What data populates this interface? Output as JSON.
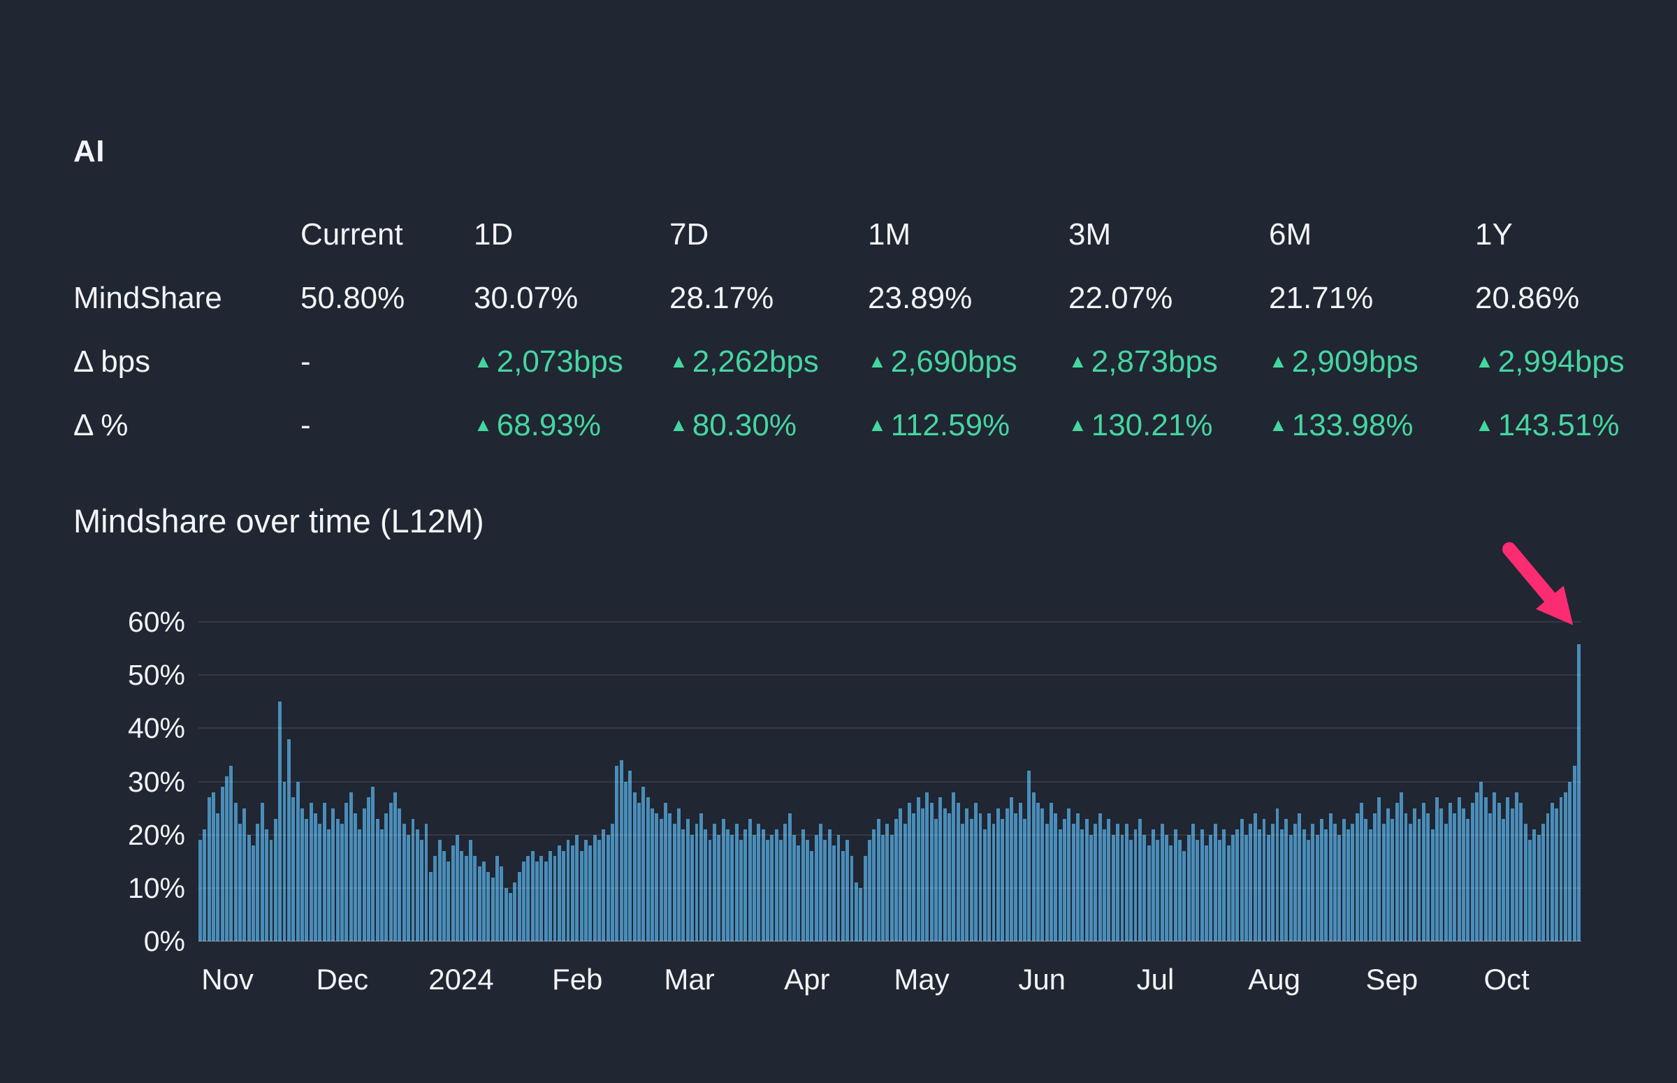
{
  "page": {
    "title": "AI"
  },
  "table": {
    "columns": [
      "Current",
      "1D",
      "7D",
      "1M",
      "3M",
      "6M",
      "1Y"
    ],
    "rows": [
      {
        "label": "MindShare",
        "values": [
          "50.80%",
          "30.07%",
          "28.17%",
          "23.89%",
          "22.07%",
          "21.71%",
          "20.86%"
        ]
      },
      {
        "label": "Δ bps",
        "values": [
          "-",
          "2,073bps",
          "2,262bps",
          "2,690bps",
          "2,873bps",
          "2,909bps",
          "2,994bps"
        ]
      },
      {
        "label": "Δ %",
        "values": [
          "-",
          "68.93%",
          "80.30%",
          "112.59%",
          "130.21%",
          "133.98%",
          "143.51%"
        ]
      }
    ],
    "up_triangle": "▲"
  },
  "section": {
    "heading": "Mindshare over time (L12M)"
  },
  "chart_data": {
    "type": "bar",
    "title": "Mindshare over time (L12M)",
    "xlabel": "",
    "ylabel": "",
    "ylim": [
      0,
      60
    ],
    "grid": true,
    "yticks": [
      "0%",
      "10%",
      "20%",
      "30%",
      "40%",
      "50%",
      "60%"
    ],
    "x_labels": [
      "Nov",
      "Dec",
      "2024",
      "Feb",
      "Mar",
      "Apr",
      "May",
      "Jun",
      "Jul",
      "Aug",
      "Sep",
      "Oct"
    ],
    "x_label_fractions": [
      0.021,
      0.104,
      0.19,
      0.274,
      0.355,
      0.44,
      0.523,
      0.61,
      0.692,
      0.778,
      0.863,
      0.946
    ],
    "current_value_pct": 50.8,
    "values": [
      19,
      21,
      27,
      28,
      24,
      29,
      31,
      33,
      26,
      22,
      25,
      20,
      18,
      22,
      26,
      21,
      19,
      23,
      45,
      30,
      38,
      27,
      30,
      25,
      23,
      26,
      24,
      22,
      26,
      21,
      25,
      23,
      22,
      26,
      28,
      24,
      21,
      25,
      27,
      29,
      23,
      21,
      24,
      26,
      28,
      25,
      22,
      20,
      23,
      21,
      19,
      22,
      13,
      16,
      19,
      17,
      15,
      18,
      20,
      17,
      16,
      19,
      16,
      14,
      15,
      13,
      12,
      16,
      14,
      10,
      9,
      11,
      13,
      15,
      16,
      17,
      15,
      16,
      15,
      17,
      16,
      18,
      17,
      19,
      18,
      20,
      17,
      19,
      18,
      20,
      19,
      21,
      20,
      22,
      33,
      34,
      30,
      32,
      28,
      26,
      29,
      27,
      25,
      24,
      23,
      26,
      24,
      22,
      25,
      21,
      23,
      20,
      22,
      24,
      21,
      19,
      22,
      20,
      23,
      21,
      20,
      22,
      19,
      21,
      23,
      20,
      22,
      21,
      19,
      20,
      21,
      19,
      22,
      24,
      20,
      18,
      21,
      19,
      17,
      20,
      22,
      19,
      21,
      18,
      20,
      17,
      19,
      16,
      11,
      10,
      16,
      19,
      21,
      23,
      20,
      22,
      20,
      23,
      25,
      22,
      26,
      24,
      27,
      25,
      28,
      26,
      23,
      27,
      25,
      24,
      28,
      26,
      22,
      25,
      23,
      26,
      24,
      21,
      24,
      22,
      25,
      23,
      25,
      27,
      24,
      26,
      23,
      32,
      28,
      26,
      25,
      22,
      26,
      24,
      21,
      23,
      25,
      22,
      24,
      21,
      23,
      20,
      22,
      24,
      21,
      23,
      20,
      22,
      20,
      22,
      19,
      21,
      23,
      20,
      18,
      21,
      19,
      22,
      20,
      18,
      21,
      19,
      17,
      20,
      22,
      19,
      21,
      18,
      20,
      22,
      19,
      21,
      18,
      20,
      21,
      23,
      20,
      22,
      24,
      21,
      23,
      20,
      22,
      25,
      21,
      23,
      20,
      22,
      24,
      21,
      19,
      22,
      20,
      23,
      21,
      24,
      22,
      20,
      23,
      21,
      22,
      24,
      26,
      23,
      21,
      24,
      27,
      22,
      25,
      23,
      26,
      28,
      24,
      22,
      25,
      23,
      26,
      24,
      21,
      27,
      25,
      22,
      26,
      24,
      27,
      25,
      23,
      26,
      28,
      30,
      27,
      24,
      28,
      26,
      23,
      27,
      25,
      28,
      26,
      22,
      19,
      21,
      20,
      22,
      24,
      26,
      25,
      27,
      28,
      30,
      33,
      55.8
    ],
    "annotation": {
      "type": "arrow",
      "target": "last-bar",
      "color": "#fb2c72"
    },
    "colors": {
      "bar": "#4a8db9",
      "background": "#202632",
      "positive_green": "#45d6a0"
    },
    "legend": null
  }
}
